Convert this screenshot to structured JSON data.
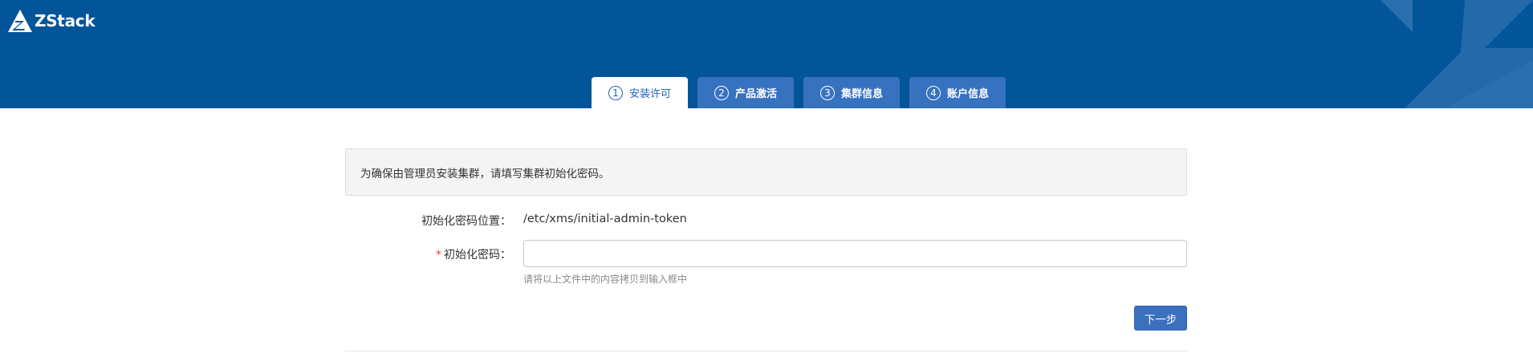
{
  "brand": {
    "name": "ZStack"
  },
  "header": {
    "bg_color": "#03559a"
  },
  "steps": [
    {
      "number": "1",
      "label": "安装许可",
      "active": true
    },
    {
      "number": "2",
      "label": "产品激活",
      "active": false
    },
    {
      "number": "3",
      "label": "集群信息",
      "active": false
    },
    {
      "number": "4",
      "label": "账户信息",
      "active": false
    }
  ],
  "notice": {
    "text": "为确保由管理员安装集群，请填写集群初始化密码。"
  },
  "form": {
    "location_label": "初始化密码位置：",
    "location_value": "/etc/xms/initial-admin-token",
    "password_required_mark": "*",
    "password_label": "初始化密码：",
    "password_value": "",
    "password_hint": "请将以上文件中的内容拷贝到输入框中"
  },
  "actions": {
    "next_label": "下一步"
  },
  "colors": {
    "accent": "#3a70bd",
    "tab_inactive": "#3772c1",
    "active_text": "#1f62b7",
    "required": "#e03c3c"
  }
}
